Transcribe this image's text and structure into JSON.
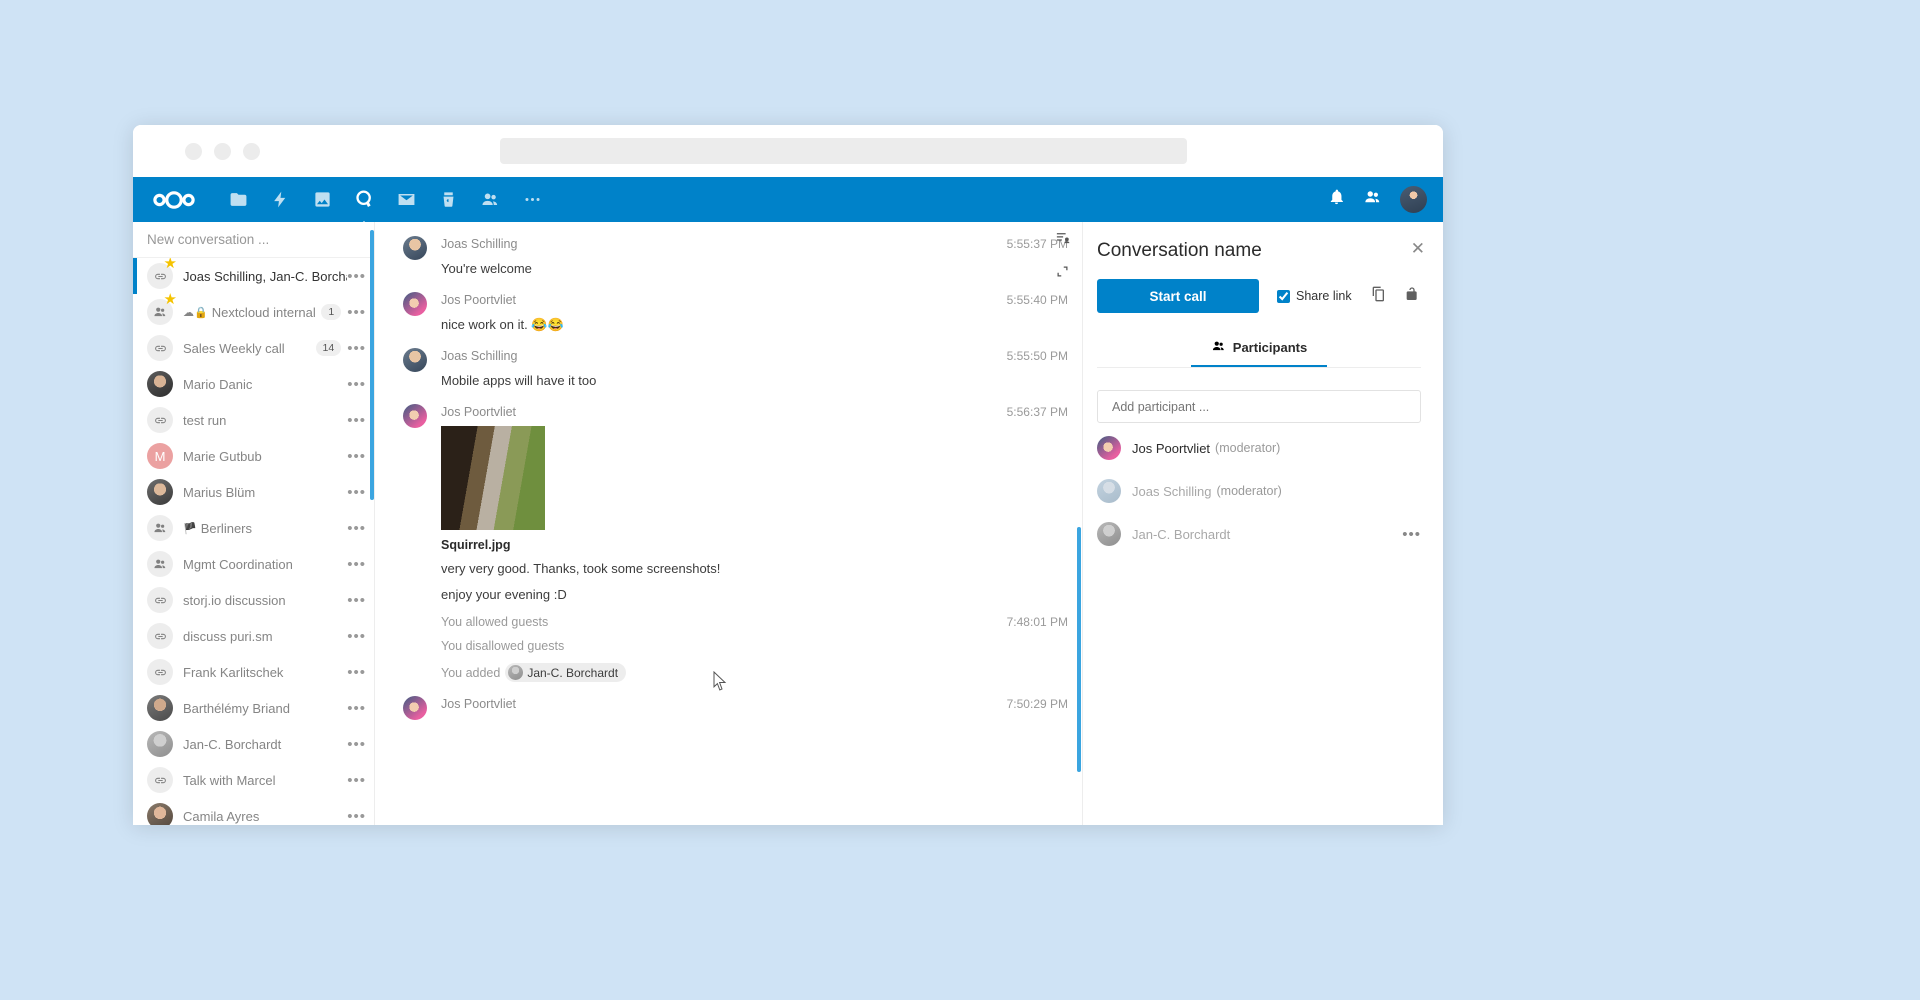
{
  "browser": {
    "url_value": ""
  },
  "topbar": {
    "logo": "nextcloud-logo",
    "nav": [
      {
        "name": "files-icon",
        "label": "Files"
      },
      {
        "name": "activity-icon",
        "label": "Activity"
      },
      {
        "name": "photos-icon",
        "label": "Photos"
      },
      {
        "name": "talk-icon",
        "label": "Talk",
        "active": true
      },
      {
        "name": "mail-icon",
        "label": "Mail"
      },
      {
        "name": "deck-icon",
        "label": "Deck"
      },
      {
        "name": "contacts-icon",
        "label": "Contacts"
      },
      {
        "name": "more-apps-icon",
        "label": "More apps"
      }
    ],
    "right": [
      {
        "name": "notifications-icon",
        "label": "Notifications"
      },
      {
        "name": "contacts-menu-icon",
        "label": "Contacts"
      },
      {
        "name": "user-avatar",
        "label": "Settings"
      }
    ]
  },
  "sidebar": {
    "new_conversation_placeholder": "New conversation ...",
    "conversations": [
      {
        "name": "Joas Schilling, Jan-C. Borchardt",
        "icon": "link-icon",
        "favorite": true,
        "selected": true,
        "badge": "",
        "prefix": ""
      },
      {
        "name": "Nextcloud internal",
        "icon": "group-icon",
        "favorite": true,
        "selected": false,
        "badge": "1",
        "prefix": "☁🔒"
      },
      {
        "name": "Sales Weekly call",
        "icon": "link-icon",
        "favorite": false,
        "selected": false,
        "badge": "14",
        "prefix": ""
      },
      {
        "name": "Mario Danic",
        "icon": "photo",
        "favorite": false,
        "selected": false,
        "badge": "",
        "prefix": ""
      },
      {
        "name": "test run",
        "icon": "link-icon",
        "favorite": false,
        "selected": false,
        "badge": "",
        "prefix": ""
      },
      {
        "name": "Marie Gutbub",
        "icon": "letter",
        "letter": "M",
        "favorite": false,
        "selected": false,
        "badge": "",
        "prefix": ""
      },
      {
        "name": "Marius Blüm",
        "icon": "photo",
        "favorite": false,
        "selected": false,
        "badge": "",
        "prefix": ""
      },
      {
        "name": "Berliners",
        "icon": "group-icon",
        "favorite": false,
        "selected": false,
        "badge": "",
        "prefix": "🏴"
      },
      {
        "name": "Mgmt Coordination",
        "icon": "group-icon",
        "favorite": false,
        "selected": false,
        "badge": "",
        "prefix": ""
      },
      {
        "name": "storj.io discussion",
        "icon": "link-icon",
        "favorite": false,
        "selected": false,
        "badge": "",
        "prefix": ""
      },
      {
        "name": "discuss puri.sm",
        "icon": "link-icon",
        "favorite": false,
        "selected": false,
        "badge": "",
        "prefix": ""
      },
      {
        "name": "Frank Karlitschek",
        "icon": "link-icon",
        "favorite": false,
        "selected": false,
        "badge": "",
        "prefix": ""
      },
      {
        "name": "Barthélémy Briand",
        "icon": "photo",
        "favorite": false,
        "selected": false,
        "badge": "",
        "prefix": ""
      },
      {
        "name": "Jan-C. Borchardt",
        "icon": "photo",
        "favorite": false,
        "selected": false,
        "badge": "",
        "prefix": ""
      },
      {
        "name": "Talk with Marcel",
        "icon": "link-icon",
        "favorite": false,
        "selected": false,
        "badge": "",
        "prefix": ""
      },
      {
        "name": "Camila Ayres",
        "icon": "photo",
        "favorite": false,
        "selected": false,
        "badge": "",
        "prefix": ""
      }
    ],
    "menu_glyph": "•••"
  },
  "chat": {
    "icons": [
      {
        "name": "sort-participants-icon"
      },
      {
        "name": "fullscreen-icon"
      }
    ],
    "messages": [
      {
        "type": "message",
        "author": "Joas Schilling",
        "time": "5:55:37 PM",
        "text": "You're welcome"
      },
      {
        "type": "message",
        "author": "Jos Poortvliet",
        "time": "5:55:40 PM",
        "text": "nice work on it. 😂😂"
      },
      {
        "type": "message",
        "author": "Joas Schilling",
        "time": "5:55:50 PM",
        "text": "Mobile apps will have it too"
      },
      {
        "type": "attachment",
        "author": "Jos Poortvliet",
        "time": "5:56:37 PM",
        "file_name": "Squirrel.jpg",
        "lines": [
          "very very good. Thanks, took some screenshots!",
          "enjoy your evening :D"
        ]
      },
      {
        "type": "system",
        "text": "You allowed guests",
        "time": "7:48:01 PM"
      },
      {
        "type": "system",
        "text": "You disallowed guests",
        "time": ""
      },
      {
        "type": "system",
        "text": "You added",
        "mention": "Jan-C. Borchardt",
        "time": ""
      },
      {
        "type": "message",
        "author": "Jos Poortvliet",
        "time": "7:50:29 PM",
        "text": ""
      }
    ]
  },
  "right_panel": {
    "title": "Conversation name",
    "close_glyph": "✕",
    "start_call_label": "Start call",
    "share_link_label": "Share link",
    "share_link_checked": true,
    "icons": [
      {
        "name": "copy-link-icon"
      },
      {
        "name": "unlock-icon"
      }
    ],
    "tab_participants_label": "Participants",
    "add_participant_placeholder": "Add participant ...",
    "participants": [
      {
        "name": "Jos Poortvliet",
        "role": "(moderator)",
        "online": true,
        "menu": false
      },
      {
        "name": "Joas Schilling",
        "role": "(moderator)",
        "online": false,
        "menu": false
      },
      {
        "name": "Jan-C. Borchardt",
        "role": "",
        "online": false,
        "menu": true
      }
    ],
    "menu_glyph": "•••"
  },
  "colors": {
    "brand_blue": "#0082c9",
    "accent_scroll": "#3ba5e0",
    "star_yellow": "#f5c300"
  }
}
